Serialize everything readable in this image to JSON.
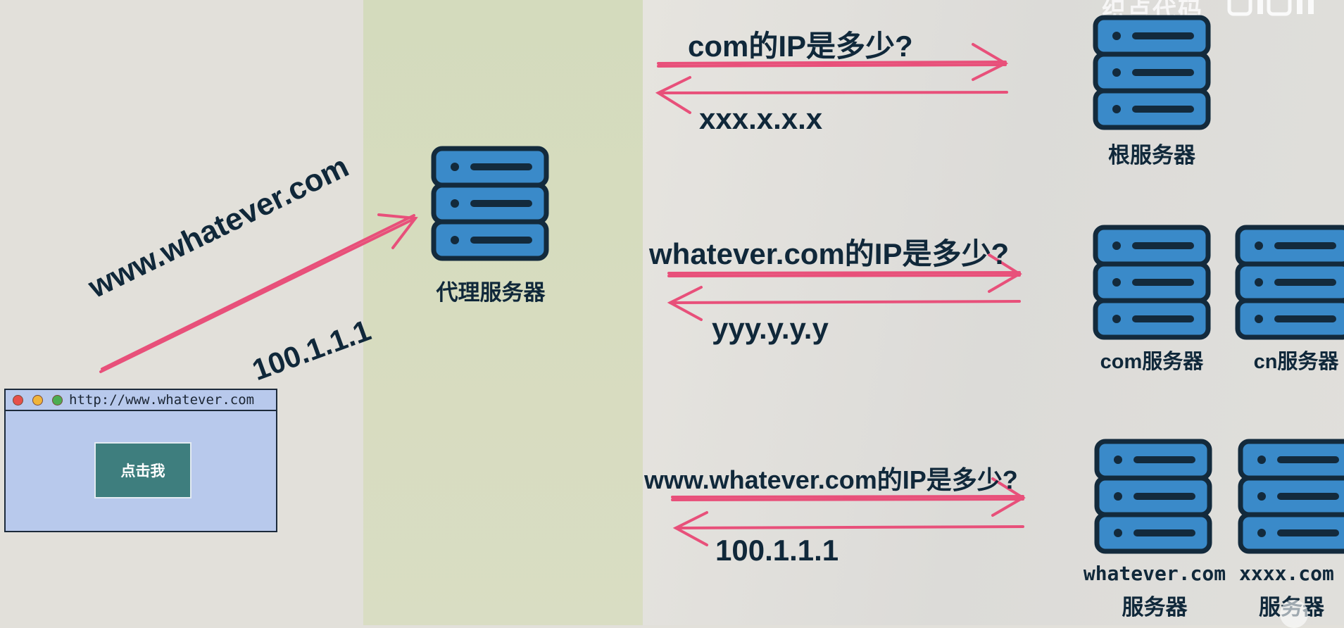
{
  "watermark": {
    "text": "织点代码",
    "logo": "bilibili"
  },
  "proxy": {
    "label": "代理服务器"
  },
  "client": {
    "request_label": "www.whatever.com",
    "response_label": "100.1.1.1",
    "browser": {
      "url": "http://www.whatever.com",
      "button_label": "点击我"
    }
  },
  "queries": [
    {
      "question": "com的IP是多少?",
      "answer": "xxx.x.x.x"
    },
    {
      "question": "whatever.com的IP是多少?",
      "answer": "yyy.y.y.y"
    },
    {
      "question": "www.whatever.com的IP是多少?",
      "answer": "100.1.1.1"
    }
  ],
  "servers": {
    "root": "根服务器",
    "com": "com服务器",
    "cn": "cn服务器",
    "whatever_line1": "whatever.com",
    "whatever_line2": "服务器",
    "xxxx_line1": "xxxx.com",
    "xxxx_line2": "服务器"
  },
  "colors": {
    "arrow": "#e8507a",
    "server_fill": "#3a8ac9",
    "server_stroke": "#132a3c",
    "proxy_band": "#d5dbbe",
    "browser_bg": "#b8c9ec",
    "button_bg": "#3e7e7e"
  }
}
